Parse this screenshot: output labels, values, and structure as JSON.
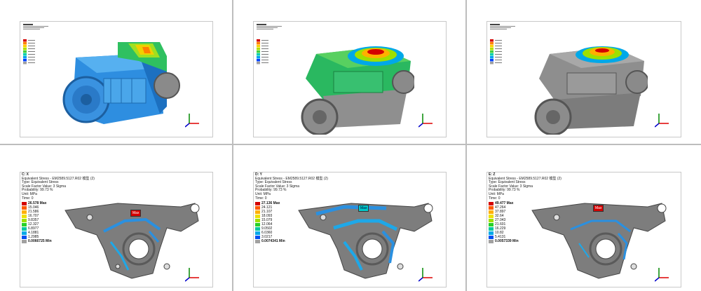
{
  "bottom_panels": [
    {
      "title": "C: X",
      "line1": "Equivalent Stress - EM2589.5127.R02 模型 (2)",
      "line2": "Type: Equivalent Stress",
      "line3": "Scale Factor Value: 3 Sigma",
      "line4": "Probability: 99.73 %",
      "line5": "Unit: MPa",
      "line6": "Time: 0",
      "legend": [
        "26.578 Max",
        "15.046",
        "21.586",
        "16.707",
        "9.8357",
        "12.327",
        "6.8977",
        "4.1881",
        "1.2985",
        "0.0066725 Min"
      ],
      "max_tag": "Max"
    },
    {
      "title": "D: Y",
      "line1": "Equivalent Stress - EM2589.5127.R02 模型 (2)",
      "line2": "Type: Equivalent Stress",
      "line3": "Scale Factor Value: 3 Sigma",
      "line4": "Probability: 99.73 %",
      "line5": "Unit: MPa",
      "line6": "Time: 0",
      "legend": [
        "27.136 Max",
        "24.121",
        "21.107",
        "18.093",
        "15.079",
        "12.064",
        "9.0502",
        "6.0360",
        "3.0217",
        "0.0074341 Min"
      ],
      "max_tag": "Max"
    },
    {
      "title": "E: Z",
      "line1": "Equivalent Stress - EM2589.5127.R02 模型 (2)",
      "line2": "Type: Equivalent Stress",
      "line3": "Scale Factor Value: 3 Sigma",
      "line4": "Probability: 99.73 %",
      "line5": "Unit: MPa",
      "line6": "Time: 0",
      "legend": [
        "49.477 Max",
        "47.264",
        "37.897",
        "32.64",
        "27.043",
        "21.601",
        "16.229",
        "10.82",
        "5.4131",
        "0.0057339 Min"
      ],
      "max_tag": "Max"
    }
  ],
  "legend_colors": [
    "#d40000",
    "#ff5a00",
    "#ffb000",
    "#f0e000",
    "#9ee000",
    "#28d028",
    "#00c8a0",
    "#00a8e8",
    "#0050f0",
    "#a0a0a0"
  ],
  "top_legend_colors": [
    "#d40000",
    "#ff8000",
    "#ffd000",
    "#b0e000",
    "#40d040",
    "#00d0b0",
    "#00a0f0",
    "#0040ff",
    "#a0a0a0"
  ]
}
